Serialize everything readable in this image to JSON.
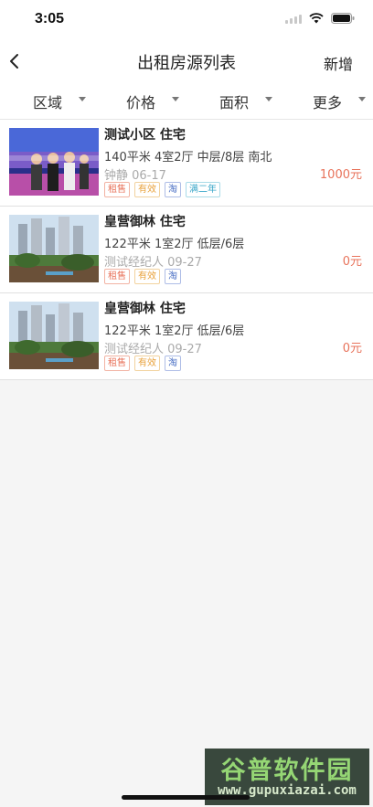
{
  "status": {
    "time": "3:05"
  },
  "nav": {
    "title": "出租房源列表",
    "add_label": "新增"
  },
  "filters": [
    {
      "label": "区域"
    },
    {
      "label": "价格"
    },
    {
      "label": "面积"
    },
    {
      "label": "更多"
    }
  ],
  "listings": [
    {
      "name": "测试小区 住宅",
      "spec": "140平米  4室2厅  中层/8层  南北",
      "agent": "钟静  06-17",
      "price": "1000元",
      "tags": [
        "租售",
        "有效",
        "淘",
        "满二年"
      ],
      "thumb": "event-photo"
    },
    {
      "name": "皇营御林 住宅",
      "spec": "122平米  1室2厅  低层/6层",
      "agent": "测试经纪人  09-27",
      "price": "0元",
      "tags": [
        "租售",
        "有效",
        "淘"
      ],
      "thumb": "estate-photo"
    },
    {
      "name": "皇营御林 住宅",
      "spec": "122平米  1室2厅  低层/6层",
      "agent": "测试经纪人  09-27",
      "price": "0元",
      "tags": [
        "租售",
        "有效",
        "淘"
      ],
      "thumb": "estate-photo"
    }
  ],
  "watermark": {
    "top": "谷普软件园",
    "bottom": "www.gupuxiazai.com"
  }
}
